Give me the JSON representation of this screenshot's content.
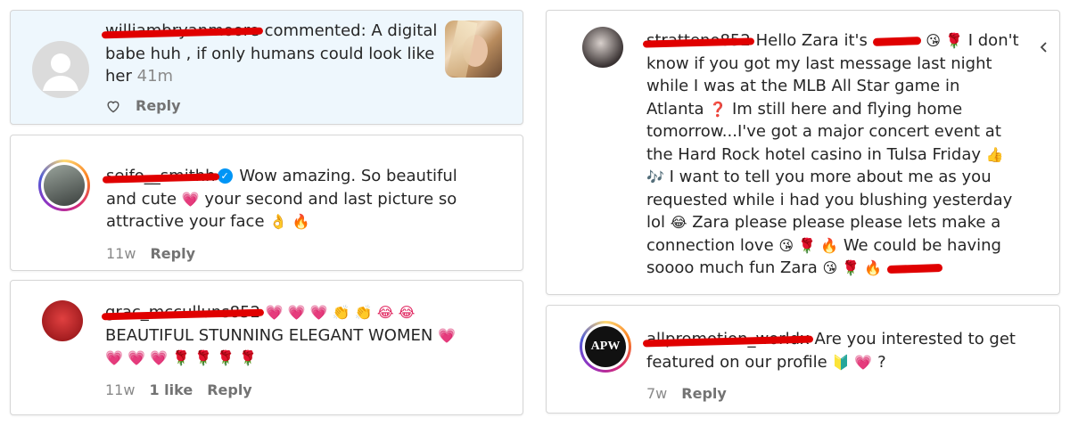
{
  "cards": [
    {
      "username": "williambryanmoore",
      "text": "commented: A digital babe huh , if only humans could look like her",
      "time": "41m",
      "reply": "Reply"
    },
    {
      "username": "seifo__smithh",
      "text_a": "Wow amazing. So beautiful and cute",
      "text_b": "your second and last picture so attractive your face",
      "time": "11w",
      "reply": "Reply"
    },
    {
      "username": "grac_mcculluns852",
      "text": "BEAUTIFUL STUNNING ELEGANT WOMEN",
      "time": "11w",
      "likes": "1 like",
      "reply": "Reply"
    },
    {
      "username": "stratteno852",
      "text_a": "Hello Zara it's",
      "text_b": "I don't know if you got my last message last night while I was at the MLB All Star game in Atlanta",
      "text_c": "Im still here and flying home tomorrow...I've got a major concert event at the Hard Rock hotel casino in Tulsa Friday",
      "text_d": "I want to tell you more about me as you requested while i had you blushing yesterday lol",
      "text_e": "Zara please please please lets make a connection love",
      "text_f": "We could be having soooo much fun Zara"
    },
    {
      "username": "allpromotion_worldx",
      "avatar_text": "APW",
      "text": "Are you interested to get featured on our profile",
      "text_end": "?",
      "time": "7w",
      "reply": "Reply"
    }
  ],
  "icons": {
    "heart_outline": "heart-outline-icon",
    "verified": "verified-badge-icon",
    "overflow": "chevron-icon"
  },
  "colors": {
    "redaction": "#e00000",
    "highlight_bg": "#eef7fd",
    "meta_text": "#737373",
    "verified_blue": "#0095f6"
  }
}
